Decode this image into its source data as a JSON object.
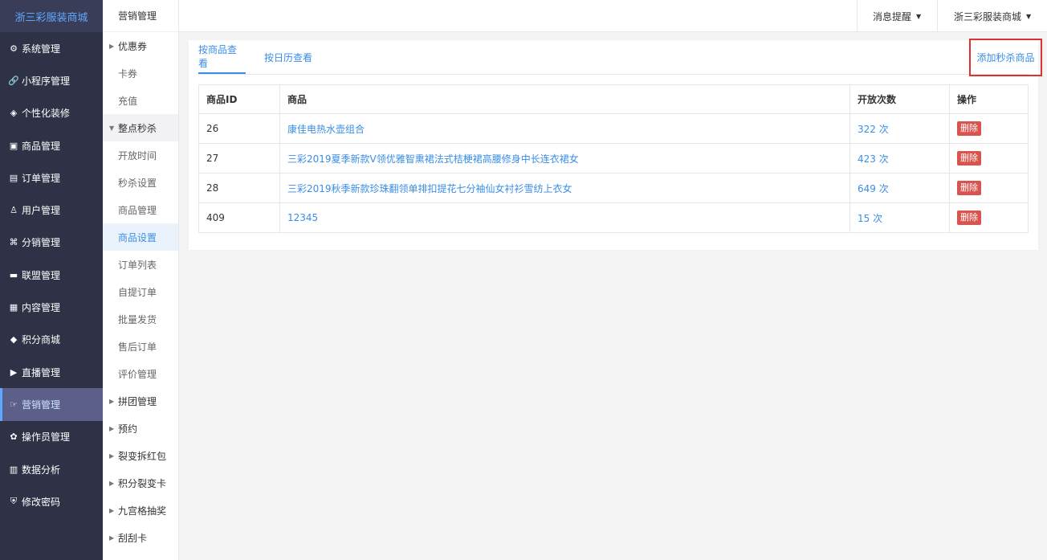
{
  "sidebar": {
    "brand": "浙三彩服装商城",
    "items": [
      {
        "label": "系统管理",
        "icon": "gear-icon",
        "glyph": "⚙"
      },
      {
        "label": "小程序管理",
        "icon": "link-icon",
        "glyph": "🔗"
      },
      {
        "label": "个性化装修",
        "icon": "diamond-icon",
        "glyph": "◈"
      },
      {
        "label": "商品管理",
        "icon": "bag-icon",
        "glyph": "▣"
      },
      {
        "label": "订单管理",
        "icon": "list-icon",
        "glyph": "▤"
      },
      {
        "label": "用户管理",
        "icon": "user-icon",
        "glyph": "♙"
      },
      {
        "label": "分销管理",
        "icon": "sitemap-icon",
        "glyph": "⌘"
      },
      {
        "label": "联盟管理",
        "icon": "store-icon",
        "glyph": "▬"
      },
      {
        "label": "内容管理",
        "icon": "doc-icon",
        "glyph": "▦"
      },
      {
        "label": "积分商城",
        "icon": "cube-icon",
        "glyph": "◆"
      },
      {
        "label": "直播管理",
        "icon": "play-icon",
        "glyph": "▶"
      },
      {
        "label": "营销管理",
        "icon": "megaphone-icon",
        "glyph": "☞"
      },
      {
        "label": "操作员管理",
        "icon": "cog-icon",
        "glyph": "✿"
      },
      {
        "label": "数据分析",
        "icon": "barchart-icon",
        "glyph": "▥"
      },
      {
        "label": "修改密码",
        "icon": "shield-icon",
        "glyph": "⛨"
      }
    ]
  },
  "submenu": {
    "header": "营销管理",
    "items": [
      {
        "label": "优惠券",
        "type": "group",
        "tri": "▶"
      },
      {
        "label": "卡券",
        "type": "child"
      },
      {
        "label": "充值",
        "type": "child"
      },
      {
        "label": "整点秒杀",
        "type": "group-open",
        "tri": "▼"
      },
      {
        "label": "开放时间",
        "type": "child"
      },
      {
        "label": "秒杀设置",
        "type": "child"
      },
      {
        "label": "商品管理",
        "type": "child"
      },
      {
        "label": "商品设置",
        "type": "child-selected"
      },
      {
        "label": "订单列表",
        "type": "child"
      },
      {
        "label": "自提订单",
        "type": "child"
      },
      {
        "label": "批量发货",
        "type": "child"
      },
      {
        "label": "售后订单",
        "type": "child"
      },
      {
        "label": "评价管理",
        "type": "child"
      },
      {
        "label": "拼团管理",
        "type": "group",
        "tri": "▶"
      },
      {
        "label": "预约",
        "type": "group",
        "tri": "▶"
      },
      {
        "label": "裂变拆红包",
        "type": "group",
        "tri": "▶"
      },
      {
        "label": "积分裂变卡",
        "type": "group",
        "tri": "▶"
      },
      {
        "label": "九宫格抽奖",
        "type": "group",
        "tri": "▶"
      },
      {
        "label": "刮刮卡",
        "type": "group",
        "tri": "▶"
      }
    ]
  },
  "topbar": {
    "messages": "消息提醒",
    "store": "浙三彩服装商城",
    "caret": "▼"
  },
  "tabs": [
    {
      "label": "按商品查看"
    },
    {
      "label": "按日历查看"
    }
  ],
  "add_button": "添加秒杀商品",
  "table": {
    "headers": [
      "商品ID",
      "商品",
      "开放次数",
      "操作"
    ],
    "rows": [
      {
        "id": "26",
        "product": "康佳电热水壶组合",
        "count": "322 次",
        "action": "删除"
      },
      {
        "id": "27",
        "product": "三彩2019夏季新款V领优雅智熏裙法式桔梗裙高腰修身中长连衣裙女",
        "count": "423 次",
        "action": "删除"
      },
      {
        "id": "28",
        "product": "三彩2019秋季新款珍珠翻领单排扣提花七分袖仙女衬衫雪纺上衣女",
        "count": "649 次",
        "action": "删除"
      },
      {
        "id": "409",
        "product": "12345",
        "count": "15 次",
        "action": "删除"
      }
    ]
  },
  "colors": {
    "sidebar_bg": "#2f3146",
    "accent": "#3a8ee6",
    "danger": "#d9534f",
    "highlight_border": "#e03131"
  }
}
